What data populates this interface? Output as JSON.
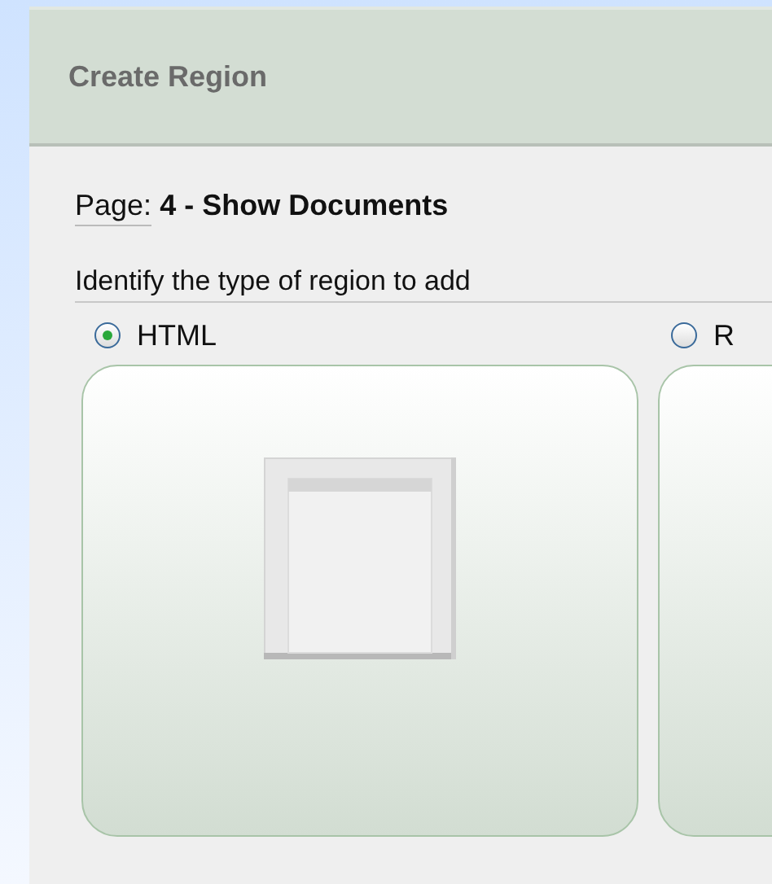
{
  "panel": {
    "title": "Create Region"
  },
  "page": {
    "label": "Page:",
    "value": "4 - Show Documents"
  },
  "prompt": "Identify the type of region to add",
  "region_types": [
    {
      "label": "HTML",
      "selected": true,
      "kind": "html"
    },
    {
      "label": "R",
      "selected": false,
      "kind": "hidden"
    }
  ]
}
